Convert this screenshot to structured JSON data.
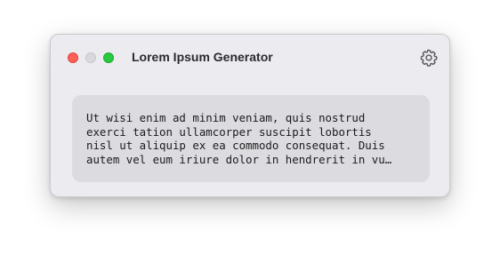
{
  "window": {
    "title": "Lorem Ipsum Generator",
    "controls": [
      "close",
      "minimize",
      "zoom"
    ],
    "settings_icon": "gear-icon"
  },
  "content": {
    "lines": [
      "Ut wisi enim ad minim veniam, quis nostrud",
      "exerci tation ullamcorper suscipit lobortis",
      "nisl ut aliquip ex ea commodo consequat. Duis",
      "autem vel eum iriure dolor in hendrerit in vu…"
    ]
  },
  "colors": {
    "close": "#fe5f57",
    "minimize": "#d9d9dc",
    "zoom": "#28c840"
  }
}
